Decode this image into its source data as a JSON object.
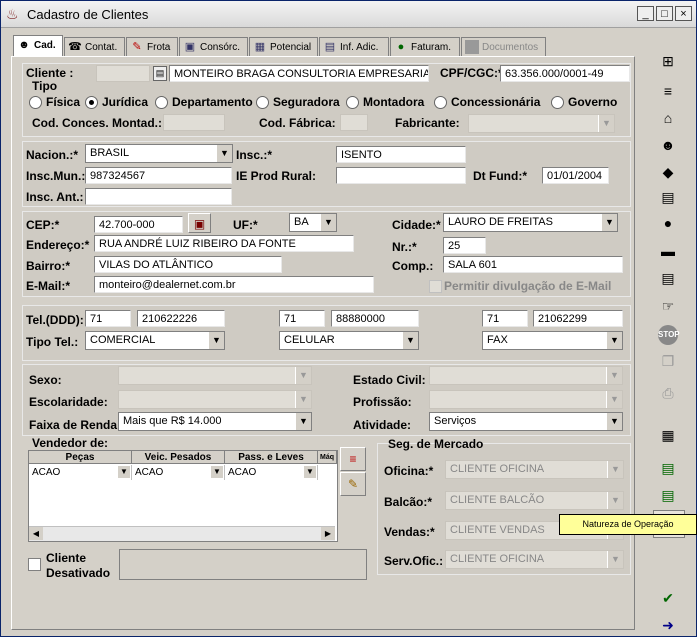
{
  "window": {
    "title": "Cadastro de Clientes"
  },
  "tabs": [
    {
      "label": "Cad.",
      "icon": "person-running-icon"
    },
    {
      "label": "Contat.",
      "icon": "phone-icon"
    },
    {
      "label": "Frota",
      "icon": "pen-icon"
    },
    {
      "label": "Consórc.",
      "icon": "folder-icon"
    },
    {
      "label": "Potencial",
      "icon": "chart-icon"
    },
    {
      "label": "Inf. Adic.",
      "icon": "list-icon"
    },
    {
      "label": "Faturam.",
      "icon": "money-bag-icon"
    },
    {
      "label": "Documentos",
      "icon": "document-icon"
    }
  ],
  "cliente": {
    "label_cliente": "Cliente :",
    "label_tipo": "Tipo",
    "name": "MONTEIRO BRAGA CONSULTORIA EMPRESARIAL LT",
    "label_cpf": "CPF/CGC:*",
    "cpf": "63.356.000/0001-49"
  },
  "tipo_options": [
    "Física",
    "Jurídica",
    "Departamento",
    "Seguradora",
    "Montadora",
    "Concessionária",
    "Governo"
  ],
  "tipo_selected": "Jurídica",
  "conces": {
    "label_cod_conces": "Cod. Conces. Montad.:",
    "label_cod_fabrica": "Cod. Fábrica:",
    "label_fabricante": "Fabricante:"
  },
  "ident": {
    "label_nacion": "Nacion.:*",
    "nacion": "BRASIL",
    "label_insc": "Insc.:*",
    "insc": "ISENTO",
    "label_insc_mun": "Insc.Mun.:*",
    "insc_mun": "987324567",
    "label_ie_prod": "IE Prod Rural:",
    "label_dt_fund": "Dt Fund:*",
    "dt_fund": "01/01/2004",
    "label_insc_ant": "Insc. Ant.:"
  },
  "endereco": {
    "label_cep": "CEP:*",
    "cep": "42.700-000",
    "label_uf": "UF:*",
    "uf": "BA",
    "label_cidade": "Cidade:*",
    "cidade": "LAURO DE FREITAS",
    "label_endereco": "Endereço:*",
    "endereco": "RUA ANDRÉ LUIZ RIBEIRO DA FONTE",
    "label_nr": "Nr.:*",
    "nr": "25",
    "label_bairro": "Bairro:*",
    "bairro": "VILAS DO ATLÂNTICO",
    "label_comp": "Comp.:",
    "comp": "SALA 601",
    "label_email": "E-Mail:*",
    "email": "monteiro@dealernet.com.br",
    "label_permitir": "Permitir divulgação de E-Mail"
  },
  "telefones": {
    "label_tel": "Tel.(DDD):",
    "label_tipo": "Tipo Tel.:",
    "items": [
      {
        "ddd": "71",
        "num": "210622226",
        "tipo": "COMERCIAL"
      },
      {
        "ddd": "71",
        "num": "88880000",
        "tipo": "CELULAR"
      },
      {
        "ddd": "71",
        "num": "21062299",
        "tipo": "FAX"
      }
    ]
  },
  "perfil": {
    "label_sexo": "Sexo:",
    "label_escolaridade": "Escolaridade:",
    "label_faixa": "Faixa de Renda:",
    "faixa": "Mais que R$ 14.000",
    "label_estado_civil": "Estado Civil:",
    "label_profissao": "Profissão:",
    "label_atividade": "Atividade:",
    "atividade": "Serviços"
  },
  "vendedor": {
    "label": "Vendedor de:",
    "columns": [
      "Peças",
      "Veic. Pesados",
      "Pass. e Leves",
      "Máq"
    ],
    "row": [
      "ACAO",
      "ACAO",
      "ACAO"
    ]
  },
  "seg_mercado": {
    "label": "Seg. de Mercado",
    "label_oficina": "Oficina:*",
    "oficina": "CLIENTE OFICINA",
    "label_balcao": "Balcão:*",
    "balcao": "CLIENTE BALCÃO",
    "label_vendas": "Vendas:*",
    "vendas": "CLIENTE VENDAS",
    "label_serv": "Serv.Ofic.:",
    "serv": "CLIENTE OFICINA"
  },
  "desativado": {
    "label_line1": "Cliente",
    "label_line2": "Desativado"
  },
  "tooltip": "Natureza de Operação",
  "right_toolbar": [
    "tree-icon",
    "list-add-icon",
    "house-hand-icon",
    "person-icon",
    "tag-icon",
    "document-search-icon",
    "money-bag-icon",
    "car-icon",
    "document-icon",
    "thumbs-up-icon",
    "stop-icon",
    "copy-icon",
    "printer-icon",
    "calculator-icon",
    "green-document-icon",
    "green-document-2-icon",
    "windows-icon",
    "blank-icon",
    "check-save-icon",
    "exit-door-icon"
  ]
}
